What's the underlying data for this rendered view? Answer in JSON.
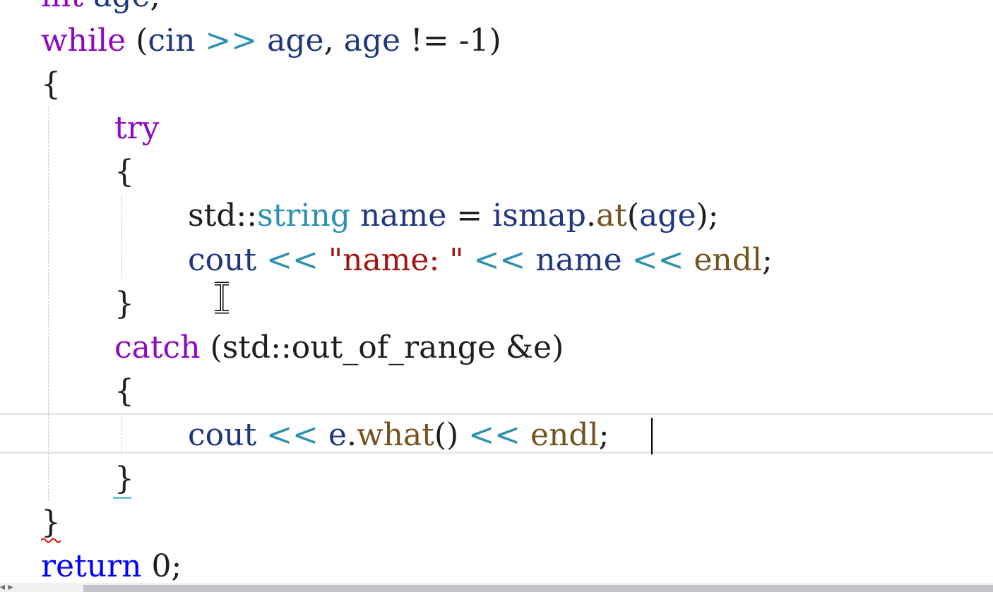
{
  "editor": {
    "language": "cpp",
    "lines": [
      {
        "id": "l0",
        "text": "int age;"
      },
      {
        "id": "l1",
        "text": "while (cin >> age, age != -1)"
      },
      {
        "id": "l2",
        "text": "{"
      },
      {
        "id": "l3",
        "text": "try"
      },
      {
        "id": "l4",
        "text": "{"
      },
      {
        "id": "l5",
        "text": "std::string name = ismap.at(age);"
      },
      {
        "id": "l6",
        "text": "cout << \"name: \" << name << endl;"
      },
      {
        "id": "l7",
        "text": "}"
      },
      {
        "id": "l8",
        "text": "catch (std::out_of_range &e)"
      },
      {
        "id": "l9",
        "text": "{"
      },
      {
        "id": "l10",
        "text": "cout << e.what() << endl;"
      },
      {
        "id": "l11",
        "text": "}"
      },
      {
        "id": "l12",
        "text": "}"
      },
      {
        "id": "l13",
        "text": "return 0;"
      }
    ],
    "tokens": {
      "int": "int",
      "age": "age",
      "semicolon": ";",
      "while": "while",
      "open_paren": "(",
      "close_paren": ")",
      "cin": "cin",
      "shr": ">>",
      "comma": ",",
      "neq": "!=",
      "neg_one": "-1",
      "open_brace": "{",
      "close_brace": "}",
      "try": "try",
      "std_ns": "std::",
      "string": "string",
      "name": "name",
      "assign": "=",
      "ismap": "ismap",
      "dot": ".",
      "at": "at",
      "cout": "cout",
      "shl": "<<",
      "str_quote_open": "\"",
      "str_name": "name: ",
      "str_quote_close": "\"",
      "endl": "endl",
      "catch": "catch",
      "out_of_range": "out_of_range",
      "amp_e": "&e",
      "e": "e",
      "what": "what",
      "call_parens": "()",
      "return": "return",
      "zero": "0"
    },
    "colors": {
      "keyword_control": "#8f08c4",
      "keyword_type": "#0000ff",
      "variable": "#1f377f",
      "type": "#2b91af",
      "function": "#74531f",
      "string": "#a31515",
      "caret": "#000000",
      "current_line_border": "#e8e8ec",
      "error_squiggle": "#e51400"
    },
    "icons": {
      "cursor": "text-ibeam-icon",
      "squiggle": "error-squiggle-icon",
      "nav_back": "nav-back-icon",
      "nav_forward": "nav-forward-icon"
    }
  }
}
